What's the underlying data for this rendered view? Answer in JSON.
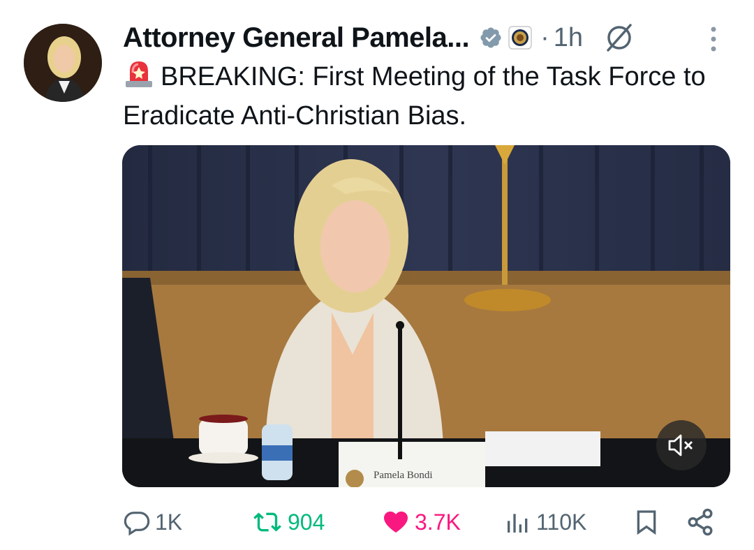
{
  "post": {
    "author_name": "Attorney General Pamela...",
    "timestamp_separator": "·",
    "timestamp": "1h",
    "text": "BREAKING: First Meeting of the Task Force to Eradicate Anti-Christian Bias.",
    "emoji": "rotating-light",
    "video": {
      "nameplate": "Pamela Bondi",
      "muted": true
    }
  },
  "actions": {
    "replies": "1K",
    "reposts": "904",
    "likes": "3.7K",
    "views": "110K"
  },
  "colors": {
    "text": "#0f1419",
    "secondary": "#536471",
    "repost": "#00ba7c",
    "like": "#f91880",
    "verified": "#829aab"
  }
}
